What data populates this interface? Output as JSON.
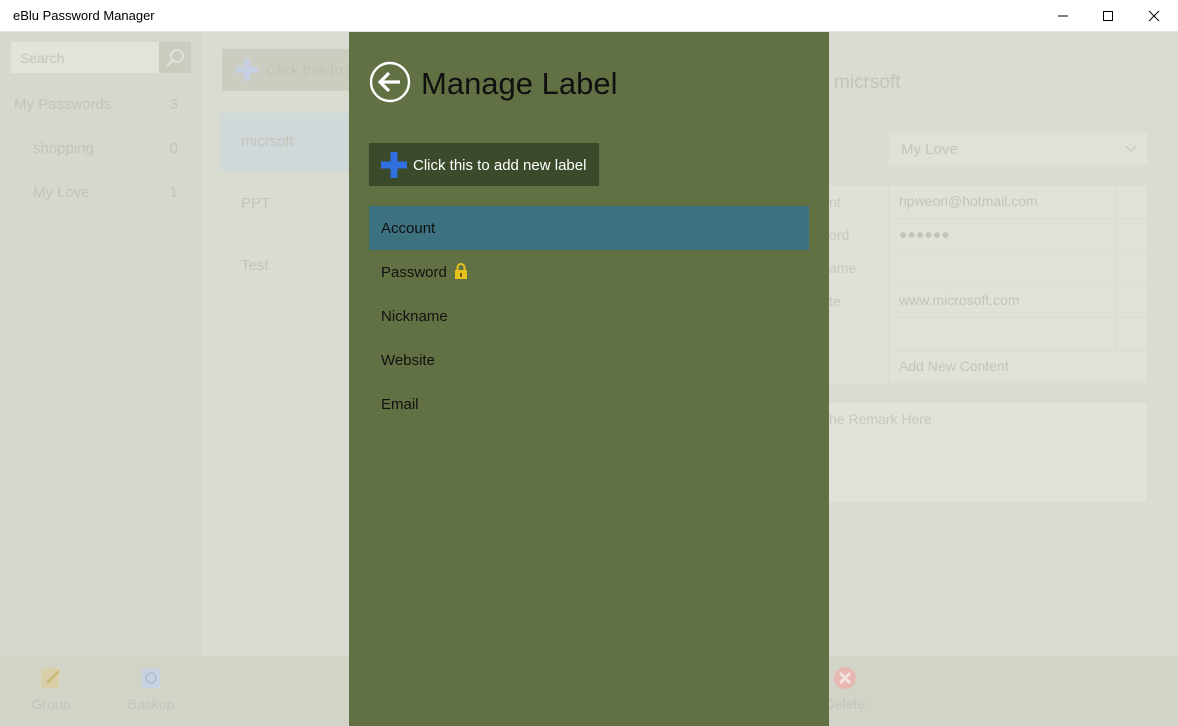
{
  "window": {
    "title": "eBlu Password Manager",
    "minimize_icon": "minimize-icon",
    "maximize_icon": "maximize-icon",
    "close_icon": "close-icon"
  },
  "sidebar": {
    "search_placeholder": "Search",
    "groups": [
      {
        "label": "My Passwords",
        "count": "3"
      },
      {
        "label": "shopping",
        "count": "0"
      },
      {
        "label": "My Love",
        "count": "1"
      }
    ],
    "tools": [
      {
        "label": "Group",
        "icon": "group-edit-icon"
      },
      {
        "label": "Backup",
        "icon": "backup-icon"
      }
    ]
  },
  "password_list": {
    "add_button_label": "Click this to a",
    "items": [
      {
        "label": "micrsoft",
        "selected": true
      },
      {
        "label": "PPT",
        "selected": false
      },
      {
        "label": "Test",
        "selected": false
      }
    ]
  },
  "detail": {
    "title": "micrsoft",
    "group_value": "My Love",
    "fields": [
      {
        "label": "nt",
        "value": "hpweori@hotmail.com"
      },
      {
        "label": "ord",
        "value": "●●●●●●"
      },
      {
        "label": "ame",
        "value": ""
      },
      {
        "label": "te",
        "value": "www.microsoft.com"
      },
      {
        "label": "",
        "value": ""
      },
      {
        "label": "",
        "value": "Add New Content"
      }
    ],
    "remark_placeholder": "he Remark Here",
    "delete_label": "Delete"
  },
  "manage_label": {
    "title": "Manage Label",
    "add_button_label": "Click this to add new label",
    "labels": [
      {
        "label": "Account",
        "selected": true,
        "locked": false
      },
      {
        "label": "Password",
        "selected": false,
        "locked": true
      },
      {
        "label": "Nickname",
        "selected": false,
        "locked": false
      },
      {
        "label": "Website",
        "selected": false,
        "locked": false
      },
      {
        "label": "Email",
        "selected": false,
        "locked": false
      }
    ]
  },
  "colors": {
    "panel_bg": "#627144",
    "selected_row": "#3c7280",
    "add_button_bg": "#3c4a2c",
    "plus_blue": "#2f6fe0",
    "lock_yellow": "#e8c21a"
  }
}
